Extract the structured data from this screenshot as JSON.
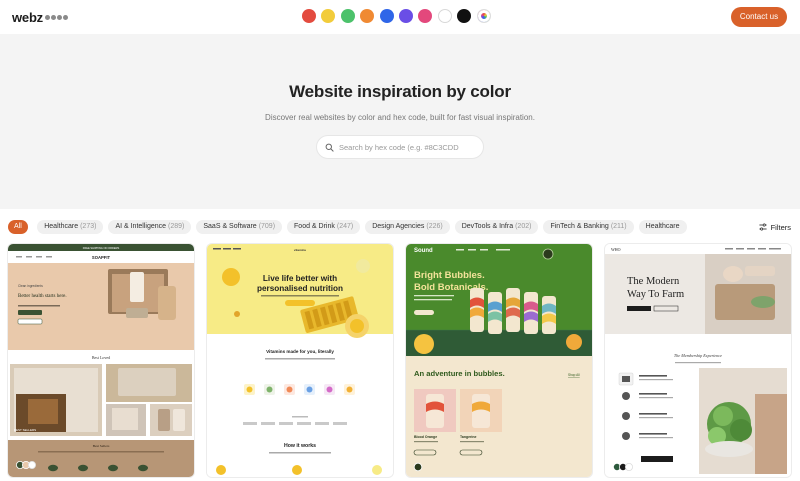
{
  "header": {
    "logo_text": "webz",
    "logo_dot_colors": [
      "#8a8a8a",
      "#8a8a8a",
      "#8a8a8a",
      "#8a8a8a"
    ],
    "color_swatches": [
      {
        "name": "red",
        "color": "#e34b3f"
      },
      {
        "name": "yellow",
        "color": "#f2cc3b"
      },
      {
        "name": "green",
        "color": "#4cc26b"
      },
      {
        "name": "orange",
        "color": "#f08a33"
      },
      {
        "name": "blue",
        "color": "#2f66e8"
      },
      {
        "name": "purple",
        "color": "#6a4ee6"
      },
      {
        "name": "pink",
        "color": "#e3487c"
      },
      {
        "name": "white",
        "color": "#ffffff"
      },
      {
        "name": "black",
        "color": "#111111"
      },
      {
        "name": "multicolor",
        "color": "conic"
      }
    ],
    "contact_label": "Contact us",
    "accent_color": "#d9612a"
  },
  "hero": {
    "title": "Website inspiration by color",
    "subtitle": "Discover real websites by color and hex code, built for fast visual inspiration.",
    "search_placeholder": "Search by hex code (e.g. #8C3CDD"
  },
  "categories": {
    "all_label": "All",
    "items": [
      {
        "label": "Healthcare",
        "count": "(273)"
      },
      {
        "label": "AI & Intelligence",
        "count": "(289)"
      },
      {
        "label": "SaaS & Software",
        "count": "(709)"
      },
      {
        "label": "Food & Drink",
        "count": "(247)"
      },
      {
        "label": "Design Agencies",
        "count": "(226)"
      },
      {
        "label": "DevTools & Infra",
        "count": "(202)"
      },
      {
        "label": "FinTech & Banking",
        "count": "(211)"
      },
      {
        "label": "Healthcare",
        "count": ""
      }
    ],
    "filters_label": "Filters"
  },
  "cards": [
    {
      "site": "SOAPFIT",
      "hero_line1": "Better health starts here.",
      "section1": "Best Loved",
      "badge": "BEST SELLERS",
      "section2": "Best Sellers",
      "palette": [
        "#3a5233",
        "#e9c9ab",
        "#ffffff",
        "#b79676"
      ]
    },
    {
      "site": "vitamins",
      "hero_line1": "Live life better with",
      "hero_line2": "personalised nutrition",
      "section1": "Vitamins made for you, literally",
      "section2": "How it works",
      "palette": [
        "#f7eb86",
        "#f3c12a",
        "#ffffff",
        "#333333"
      ]
    },
    {
      "site": "Sound",
      "hero_line1": "Bright Bubbles.",
      "hero_line2": "Bold Botanicals.",
      "section1": "An adventure in bubbles.",
      "link": "Shop All",
      "product1": "Blood Orange",
      "product2": "Tangerine",
      "palette": [
        "#4a8a2c",
        "#f3e7cf",
        "#e5a638",
        "#2b3a1d"
      ]
    },
    {
      "site": "WHO",
      "hero_line1": "The Modern",
      "hero_line2": "Way To Farm",
      "section1": "The Membership Experience",
      "palette": [
        "#2d5a3d",
        "#ece8e3",
        "#1c1c1c",
        "#ffffff"
      ]
    }
  ]
}
